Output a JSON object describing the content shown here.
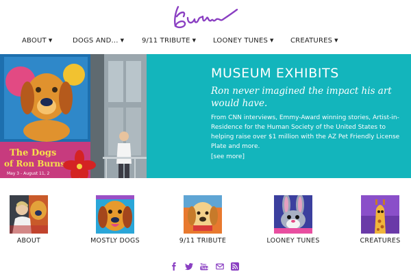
{
  "brand": {
    "logo_text": "Burns",
    "accent": "#8a3fc2"
  },
  "nav": {
    "items": [
      {
        "label": "ABOUT"
      },
      {
        "label": "DOGS AND..."
      },
      {
        "label": "9/11 TRIBUTE"
      },
      {
        "label": "LOONEY TUNES"
      },
      {
        "label": "CREATURES"
      }
    ]
  },
  "hero": {
    "title": "MUSEUM EXHIBITS",
    "subtitle": "Ron never imagined the impact his art would have.",
    "body": "From CNN interviews, Emmy-Award winning stories, Artist-in-Residence for the Human Society of the United States to helping raise over $1 million with the AZ Pet Friendly License Plate and more.",
    "link": "[see more]",
    "background": "#13b5bc",
    "banner_text": {
      "line1": "The Dogs",
      "line2": "of Ron Burns",
      "dates": "May 3 - August 11, 2"
    }
  },
  "categories": [
    {
      "label": "ABOUT"
    },
    {
      "label": "MOSTLY DOGS"
    },
    {
      "label": "9/11 TRIBUTE"
    },
    {
      "label": "LOONEY TUNES"
    },
    {
      "label": "CREATURES"
    }
  ],
  "social": [
    {
      "icon": "facebook-icon"
    },
    {
      "icon": "twitter-icon"
    },
    {
      "icon": "youtube-icon"
    },
    {
      "icon": "email-icon"
    },
    {
      "icon": "rss-icon"
    }
  ],
  "colors": {
    "icon": "#8a3fc2",
    "hero": "#13b5bc",
    "text": "#222222"
  }
}
